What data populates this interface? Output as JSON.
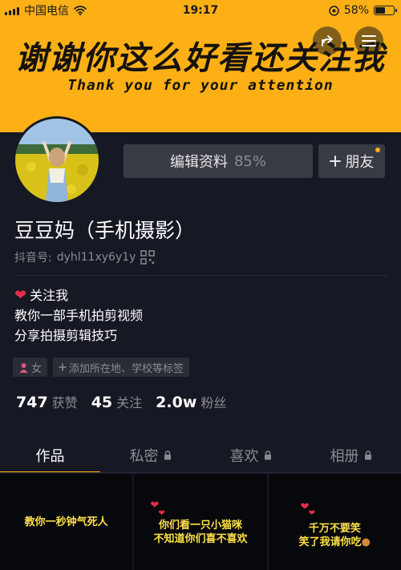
{
  "status_bar": {
    "carrier": "中国电信",
    "time": "19:17",
    "battery_percent": "58%",
    "battery_level": 0.58
  },
  "banner": {
    "title": "谢谢你这么好看还关注我",
    "subtitle": "Thank you for your attention",
    "background_color": "#fcb016"
  },
  "profile": {
    "edit_label": "编辑资料",
    "edit_progress": "85%",
    "friend_label": "朋友",
    "name": "豆豆妈（手机摄影）",
    "douyin_id_label": "抖音号:",
    "douyin_id": "dyhl11xy6y1y",
    "bio": [
      "关注我",
      "教你一部手机拍剪视频",
      "分享拍摄剪辑技巧"
    ],
    "tags": {
      "gender": "女",
      "add_tag": "添加所在地、学校等标签"
    }
  },
  "stats": [
    {
      "num": "747",
      "label": "获赞"
    },
    {
      "num": "45",
      "label": "关注"
    },
    {
      "num": "2.0w",
      "label": "粉丝"
    }
  ],
  "tabs": [
    {
      "label": "作品",
      "locked": false
    },
    {
      "label": "私密",
      "locked": true
    },
    {
      "label": "喜欢",
      "locked": true
    },
    {
      "label": "相册",
      "locked": true
    }
  ],
  "videos": [
    {
      "lines": [
        "教你一秒钟气死人"
      ]
    },
    {
      "lines": [
        "你们看一只小猫咪",
        "不知道你们喜不喜欢"
      ]
    },
    {
      "lines": [
        "千万不要笑",
        "笑了我请你吃"
      ]
    }
  ],
  "colors": {
    "accent": "#fcb016",
    "background": "#161823",
    "muted": "#8a8b91",
    "heart": "#e2304a"
  },
  "icons": [
    "wifi-icon",
    "location-lock-icon",
    "share-icon",
    "menu-icon",
    "qr-code-icon",
    "plus-icon",
    "heart-icon",
    "female-icon",
    "lock-icon",
    "burger-icon"
  ]
}
